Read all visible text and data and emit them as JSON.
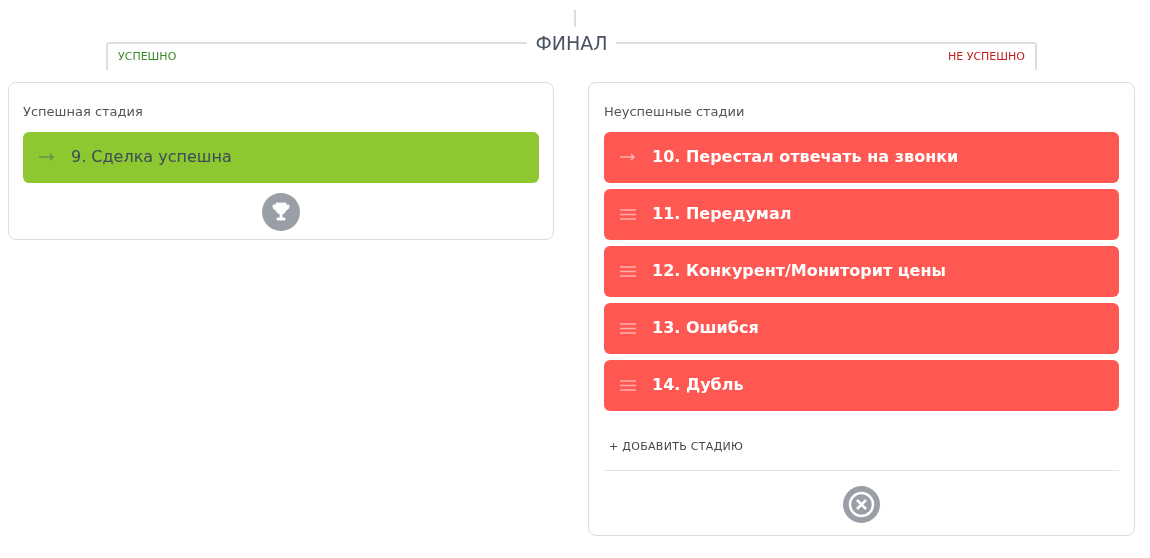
{
  "title": "ФИНАЛ",
  "branches": [
    {
      "label": "УСПЕШНО",
      "kind": "success"
    },
    {
      "label": "НЕ УСПЕШНО",
      "kind": "fail"
    }
  ],
  "success_panel": {
    "heading": "Успешная стадия",
    "stages": [
      {
        "label": "9. Сделка успешна",
        "kind": "arrow"
      }
    ]
  },
  "fail_panel": {
    "heading": "Неуспешные стадии",
    "stages": [
      {
        "label": "10. Перестал отвечать на звонки",
        "kind": "arrow"
      },
      {
        "label": "11. Передумал",
        "kind": "drag"
      },
      {
        "label": "12. Конкурент/Мониторит цены",
        "kind": "drag"
      },
      {
        "label": "13. Ошибся",
        "kind": "drag"
      },
      {
        "label": "14. Дубль",
        "kind": "drag"
      }
    ],
    "add_button": "+ ДОБАВИТЬ СТАДИЮ"
  }
}
